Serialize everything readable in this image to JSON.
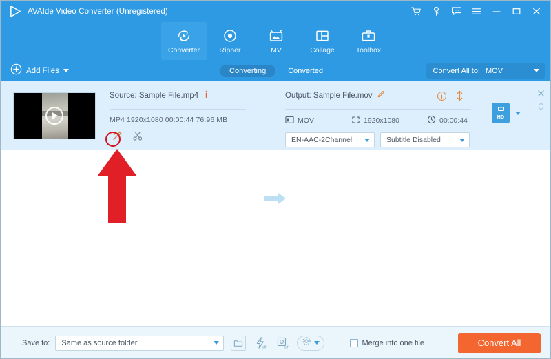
{
  "window": {
    "title": "AVAIde Video Converter (Unregistered)",
    "controls": [
      {
        "name": "cart-icon",
        "label": "Buy"
      },
      {
        "name": "key-icon",
        "label": "Register"
      },
      {
        "name": "feedback-icon",
        "label": "Feedback"
      },
      {
        "name": "menu-icon",
        "label": "Menu"
      },
      {
        "name": "minimize-icon",
        "label": "Minimize"
      },
      {
        "name": "maximize-icon",
        "label": "Maximize"
      },
      {
        "name": "close-icon",
        "label": "Close"
      }
    ]
  },
  "nav": {
    "items": [
      {
        "label": "Converter",
        "icon": "converter-icon",
        "active": true
      },
      {
        "label": "Ripper",
        "icon": "ripper-icon",
        "active": false
      },
      {
        "label": "MV",
        "icon": "mv-icon",
        "active": false
      },
      {
        "label": "Collage",
        "icon": "collage-icon",
        "active": false
      },
      {
        "label": "Toolbox",
        "icon": "toolbox-icon",
        "active": false
      }
    ]
  },
  "toolbar": {
    "add_files_label": "Add Files",
    "tabs": [
      {
        "label": "Converting",
        "active": true
      },
      {
        "label": "Converted",
        "active": false
      }
    ],
    "convert_all_to_label": "Convert All to:",
    "convert_all_to_value": "MOV"
  },
  "file_row": {
    "source_label": "Source: Sample File.mp4",
    "source_info_icon": "info-icon",
    "source_meta": "MP4   1920x1080   00:00:44   76.96 MB",
    "edit_icon": "magic-wand-edit-icon",
    "cut_icon": "scissors-trim-icon",
    "output_label": "Output: Sample File.mov",
    "output_edit_icon": "pencil-rename-icon",
    "output_info_icon": "info-circle-icon",
    "output_swap_icon": "swap-vertical-icon",
    "output_format": "MOV",
    "output_resolution": "1920x1080",
    "output_duration": "00:00:44",
    "audio_track": "EN-AAC-2Channel",
    "subtitle_track": "Subtitle Disabled",
    "quality_badge": "HD",
    "remove_icon": "close-row-icon",
    "expand_icon": "expand-collapse-icon"
  },
  "bottom": {
    "save_to_label": "Save to:",
    "save_to_value": "Same as source folder",
    "folder_icon": "open-folder-icon",
    "hwaccel_icon": "hardware-acceleration-off-icon",
    "preview_icon": "preview-off-icon",
    "settings_icon": "gear-settings-icon",
    "merge_label": "Merge into one file",
    "merge_checked": false,
    "convert_button": "Convert All"
  },
  "annotations": {
    "highlight_target": "magic-wand-edit-icon",
    "arrow_color": "#e01f26",
    "circle_color": "#d4121b"
  },
  "colors": {
    "header_blue": "#2f9ae4",
    "row_blue": "#ddeffc",
    "accent_orange": "#f3662f",
    "bottom_bar": "#eaf5fc"
  }
}
